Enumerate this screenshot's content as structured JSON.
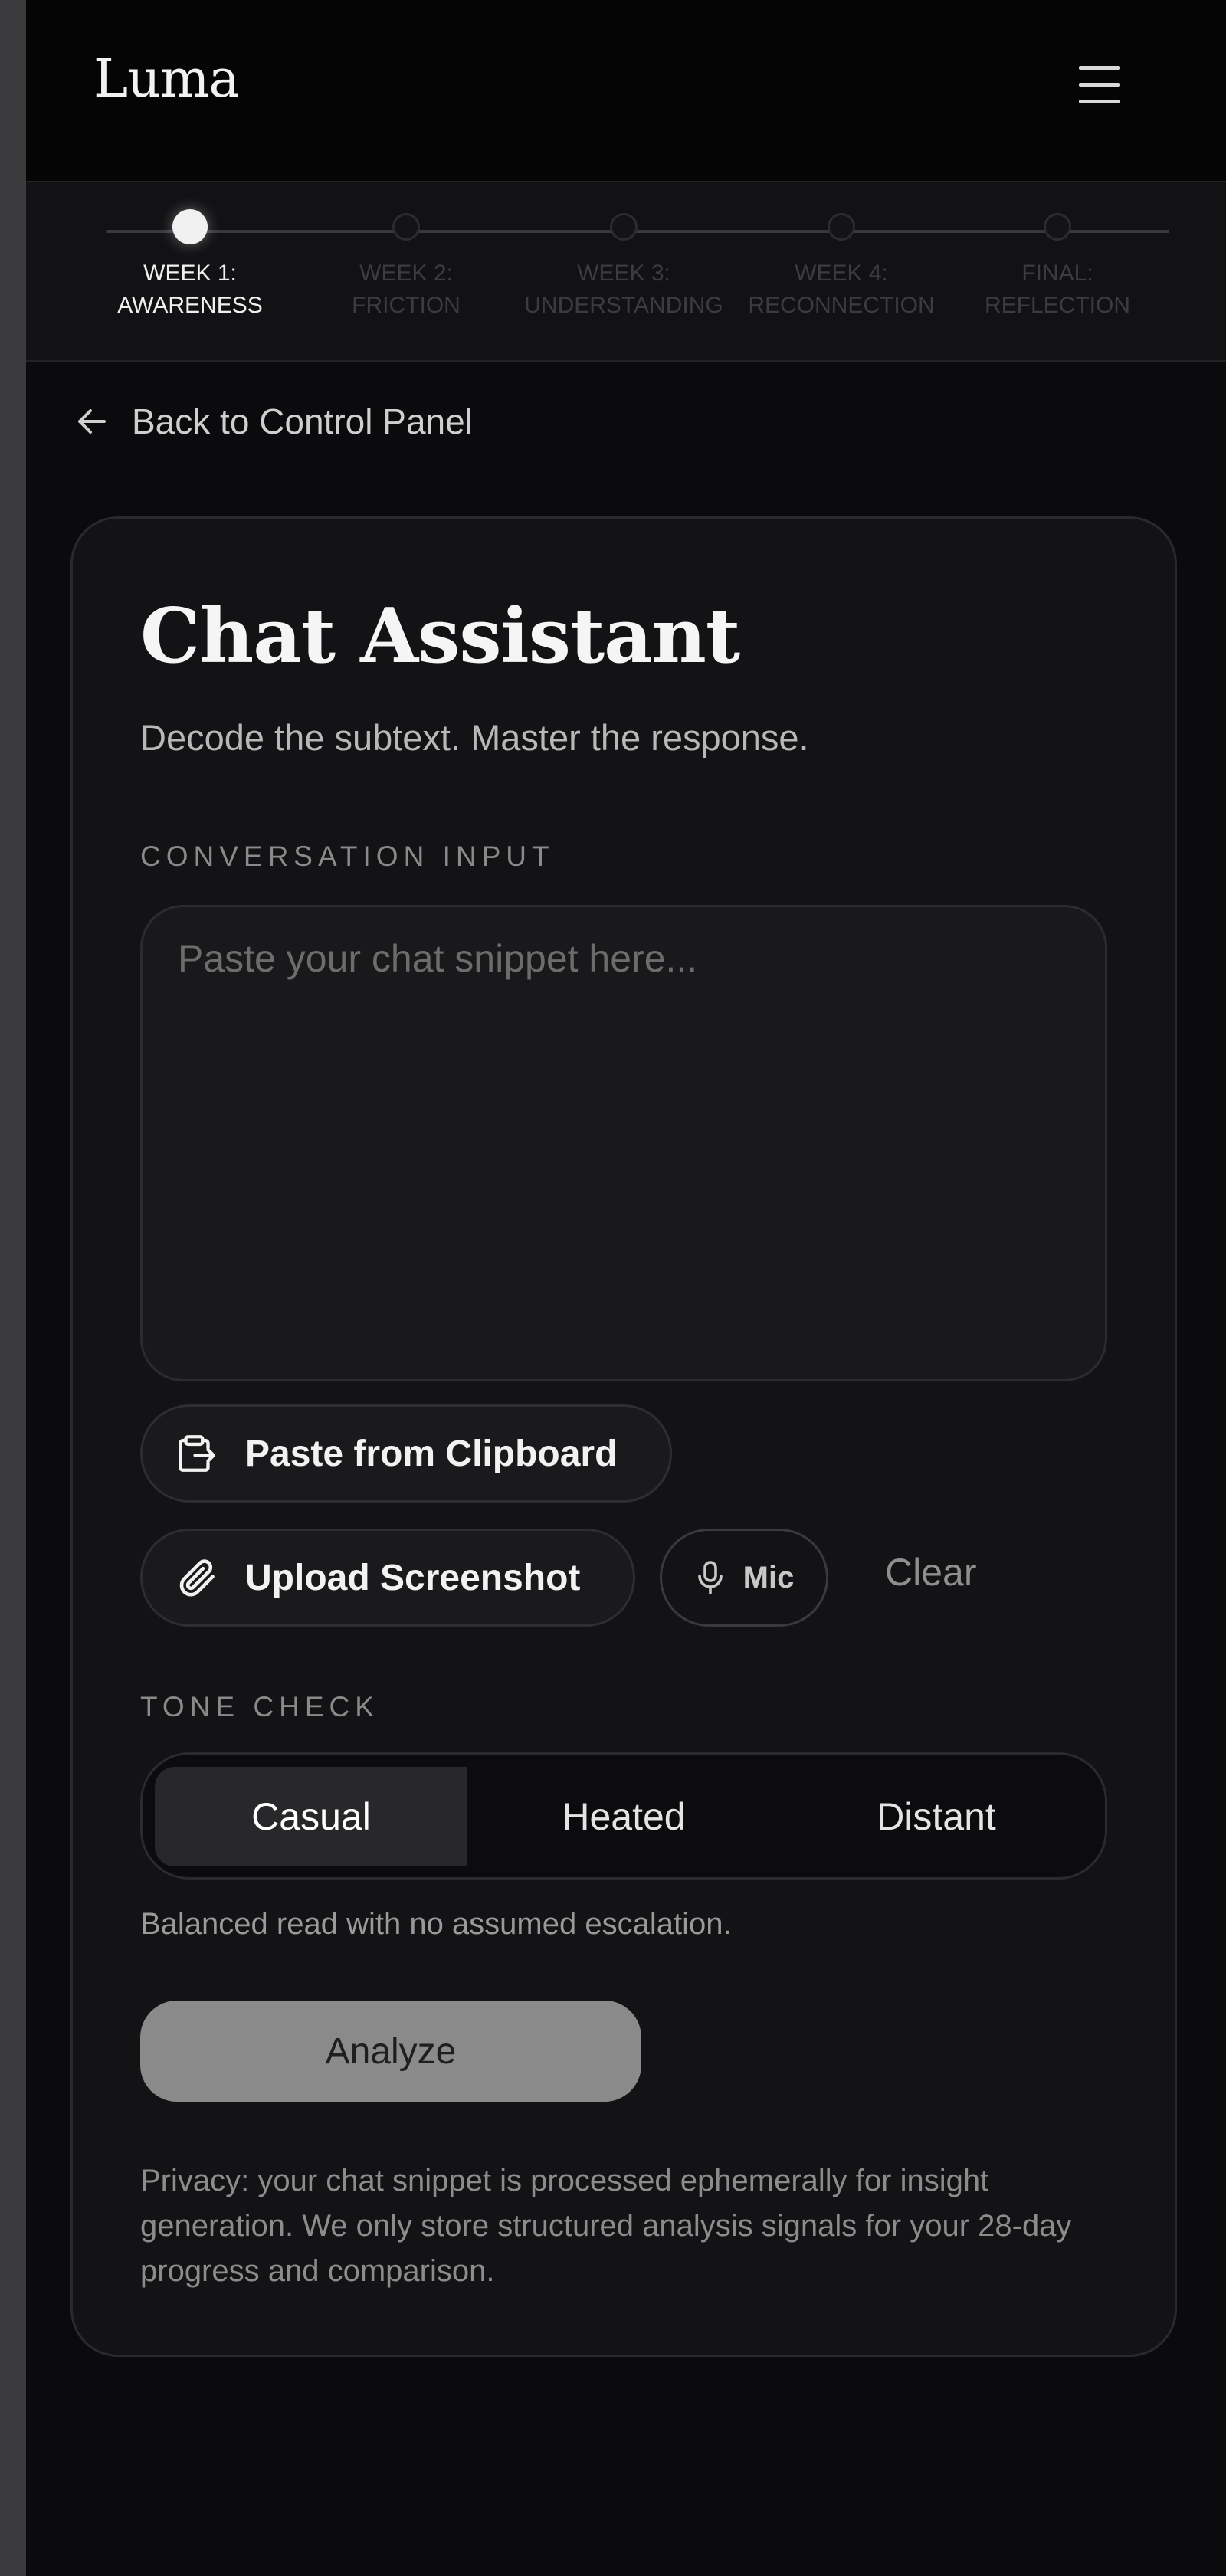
{
  "app": {
    "logo": "Luma",
    "menu_icon": "hamburger-menu-icon"
  },
  "progress": {
    "steps": [
      {
        "line1": "WEEK 1:",
        "line2": "AWARENESS",
        "active": true
      },
      {
        "line1": "WEEK 2:",
        "line2": "FRICTION",
        "active": false
      },
      {
        "line1": "WEEK 3:",
        "line2": "UNDERSTANDING",
        "active": false
      },
      {
        "line1": "WEEK 4:",
        "line2": "RECONNECTION",
        "active": false
      },
      {
        "line1": "FINAL:",
        "line2": "REFLECTION",
        "active": false
      }
    ]
  },
  "back": {
    "label": "Back to Control Panel",
    "icon": "arrow-left-icon"
  },
  "card": {
    "title": "Chat Assistant",
    "subtitle": "Decode the subtext. Master the response.",
    "input_section_label": "CONVERSATION INPUT",
    "input": {
      "placeholder": "Paste your chat snippet here...",
      "value": ""
    },
    "paste_button": {
      "label": "Paste from Clipboard",
      "icon": "clipboard-icon"
    },
    "upload_button": {
      "label": "Upload Screenshot",
      "icon": "paperclip-icon"
    },
    "mic_button": {
      "label": "Mic",
      "icon": "microphone-icon"
    },
    "clear_button": {
      "label": "Clear"
    },
    "tone_section_label": "TONE CHECK",
    "tone_options": [
      {
        "label": "Casual",
        "selected": true
      },
      {
        "label": "Heated",
        "selected": false
      },
      {
        "label": "Distant",
        "selected": false
      }
    ],
    "tone_description": "Balanced read with no assumed escalation.",
    "analyze_button": {
      "label": "Analyze"
    },
    "privacy_note": "Privacy: your chat snippet is processed ephemerally for insight generation. We only store structured analysis signals for your 28-day progress and comparison."
  },
  "colors": {
    "background": "#0b0b0d",
    "card": "#131315",
    "accent": "#f0f0f0",
    "button_disabled": "#8a8a8a"
  }
}
